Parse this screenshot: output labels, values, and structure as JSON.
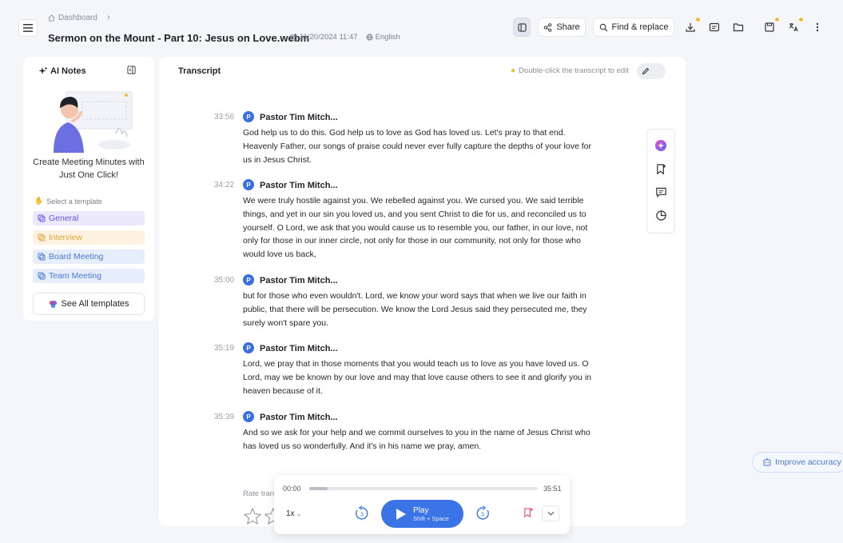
{
  "header": {
    "breadcrumb": "Dashboard",
    "title": "Sermon on the Mount - Part 10: Jesus on Love.webm",
    "date": "11/20/2024 11:47",
    "language": "English",
    "share_label": "Share",
    "find_replace_label": "Find & replace"
  },
  "left_panel": {
    "title": "AI Notes",
    "promo": "Create Meeting Minutes with Just One Click!",
    "template_label": "Select a template",
    "templates": [
      "General",
      "Interview",
      "Board Meeting",
      "Team Meeting"
    ],
    "see_all_label": "See All templates"
  },
  "transcript": {
    "title": "Transcript",
    "hint": "Double-click the transcript to edit",
    "segments": [
      {
        "time": "33:56",
        "avatar": "P",
        "speaker": "Pastor Tim Mitch...",
        "text": "God help us to do this. God help us to love as God has loved us. Let's pray to that end. Heavenly Father, our songs of praise could never ever fully capture the depths of your love for us in Jesus Christ."
      },
      {
        "time": "34:22",
        "avatar": "P",
        "speaker": "Pastor Tim Mitch...",
        "text": "We were truly hostile against you. We rebelled against you. We cursed you. We said terrible things, and yet in our sin you loved us, and you sent Christ to die for us, and reconciled us to yourself. O Lord, we ask that you would cause us to resemble you, our father, in our love, not only for those in our inner circle, not only for those in our community, not only for those who would love us back,"
      },
      {
        "time": "35:00",
        "avatar": "P",
        "speaker": "Pastor Tim Mitch...",
        "text": "but for those who even wouldn't. Lord, we know your word says that when we live our faith in public, that there will be persecution. We know the Lord Jesus said they persecuted me, they surely won't spare you."
      },
      {
        "time": "35:19",
        "avatar": "P",
        "speaker": "Pastor Tim Mitch...",
        "text": "Lord, we pray that in those moments that you would teach us to love as you have loved us. O Lord, may we be known by our love and may that love cause others to see it and glorify you in heaven because of it."
      },
      {
        "time": "35:39",
        "avatar": "P",
        "speaker": "Pastor Tim Mitch...",
        "text": "And so we ask for your help and we commit ourselves to you in the name of Jesus Christ who has loved us so wonderfully. And it's in his name we pray, amen."
      }
    ],
    "rate_label": "Rate tran"
  },
  "improve_label": "Improve accuracy",
  "player": {
    "current_time": "00:00",
    "total_time": "35:51",
    "progress": 0.08,
    "speed": "1x",
    "skip_back": "3",
    "skip_forward": "3",
    "play_label": "Play",
    "play_shortcut": "Shift + Space"
  },
  "colors": {
    "accent": "#3b74e6",
    "badge": "#f5b93b"
  }
}
